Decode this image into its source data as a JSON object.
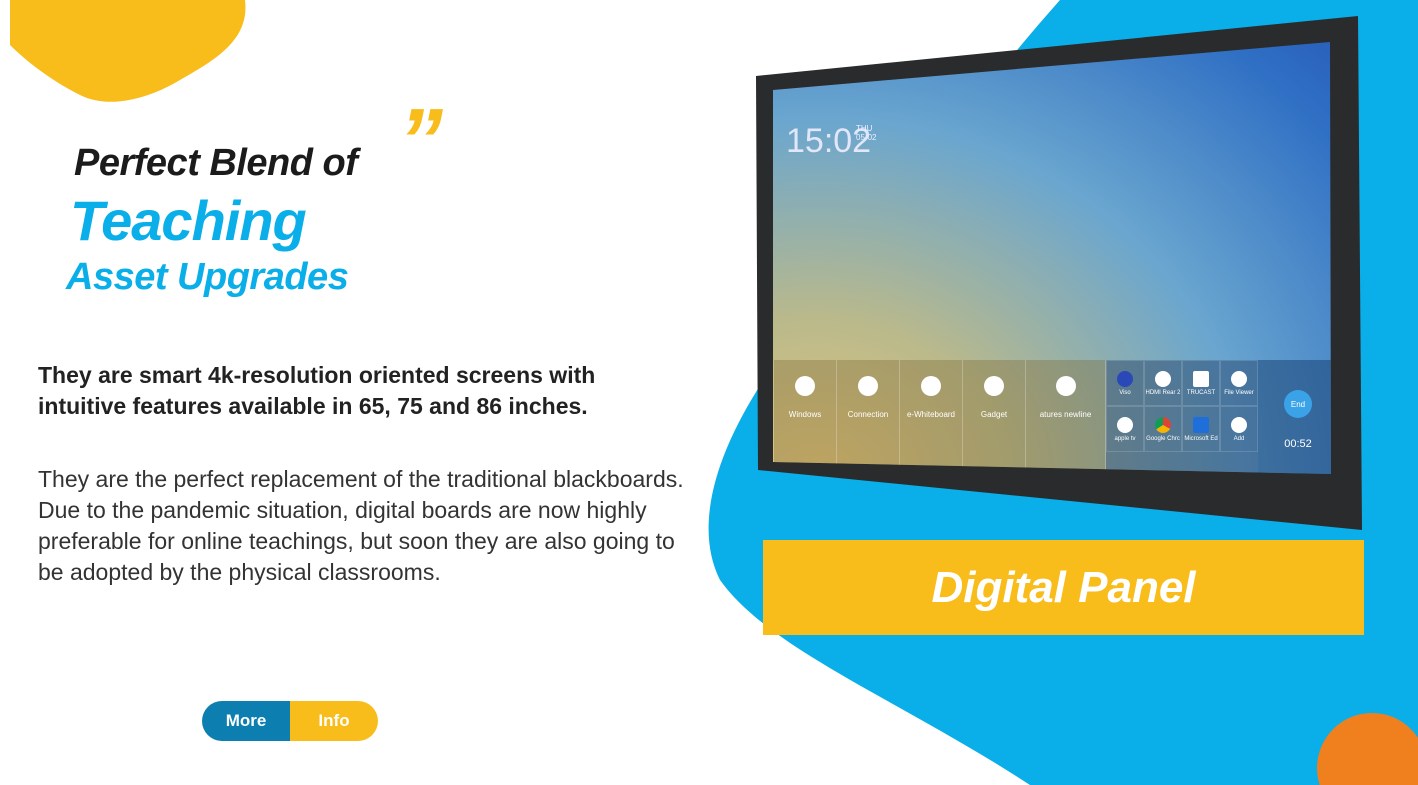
{
  "heading": {
    "line1": "Perfect Blend of",
    "line2": "Teaching",
    "line3": "Asset Upgrades",
    "quote_mark": "”"
  },
  "intro": "They are smart 4k-resolution oriented screens with intuitive features available in 65, 75 and 86 inches.",
  "body": "They are the perfect replacement of the traditional blackboards. Due to the pandemic situation, digital boards are now highly preferable for online teachings, but soon they are also going to be adopted by the physical classrooms.",
  "buttons": {
    "more": "More",
    "info": "Info"
  },
  "banner": "Digital Panel",
  "panel": {
    "time": "15:02",
    "day": "THU",
    "date": "05-02",
    "tiles": [
      "Windows",
      "Connection",
      "e-Whiteboard",
      "Gadget",
      "atures newline"
    ],
    "apps": [
      "Viso",
      "HDMI Rear 2",
      "TRUCAST",
      "File Viewer",
      "apple tv",
      "Google Chrc",
      "Microsoft Ed",
      "Add"
    ],
    "end_label": "End",
    "timer": "00:52"
  },
  "colors": {
    "blue": "#0aaee8",
    "yellow": "#f8bd1b",
    "dark_blue": "#0c7fb0",
    "orange": "#f07f1e"
  }
}
